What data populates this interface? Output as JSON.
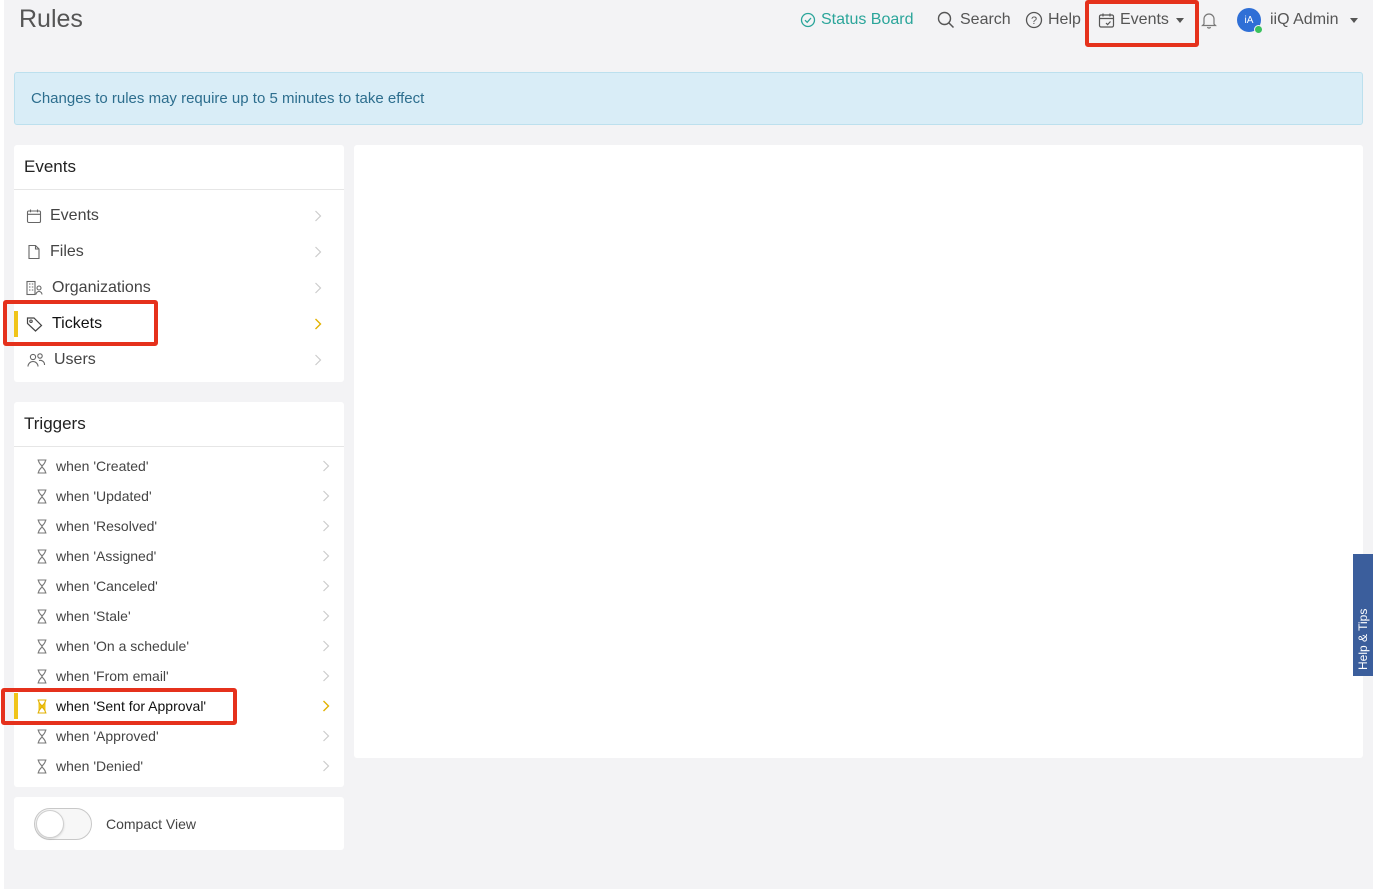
{
  "page": {
    "title": "Rules"
  },
  "nav": {
    "status_board": "Status Board",
    "search": "Search",
    "help": "Help",
    "events": "Events",
    "user": {
      "initials": "iA",
      "name": "iiQ Admin"
    }
  },
  "banner": {
    "text": "Changes to rules may require up to 5 minutes to take effect"
  },
  "events_panel": {
    "title": "Events",
    "items": [
      {
        "label": "Events",
        "icon": "calendar-icon"
      },
      {
        "label": "Files",
        "icon": "file-icon"
      },
      {
        "label": "Organizations",
        "icon": "building-icon"
      },
      {
        "label": "Tickets",
        "icon": "tag-icon",
        "active": true
      },
      {
        "label": "Users",
        "icon": "users-icon"
      }
    ]
  },
  "triggers_panel": {
    "title": "Triggers",
    "items": [
      {
        "prefix": "when ",
        "label": "'Created'"
      },
      {
        "prefix": "when ",
        "label": "'Updated'"
      },
      {
        "prefix": "when ",
        "label": "'Resolved'"
      },
      {
        "prefix": "when ",
        "label": "'Assigned'"
      },
      {
        "prefix": "when ",
        "label": "'Canceled'"
      },
      {
        "prefix": "when ",
        "label": "'Stale'"
      },
      {
        "prefix": "when ",
        "label": "'On a schedule'"
      },
      {
        "prefix": "when ",
        "label": "'From email'"
      },
      {
        "prefix": "when ",
        "label": "'Sent for Approval'",
        "active": true
      },
      {
        "prefix": "when ",
        "label": "'Approved'"
      },
      {
        "prefix": "when ",
        "label": "'Denied'"
      }
    ]
  },
  "compact_view": {
    "label": "Compact View",
    "enabled": false
  },
  "help_tab": {
    "label": "Help & Tips"
  },
  "colors": {
    "accent": "#2ba59a",
    "active_marker": "#f0c419",
    "highlight": "#e5311c",
    "help_tab": "#3b5e9c"
  }
}
